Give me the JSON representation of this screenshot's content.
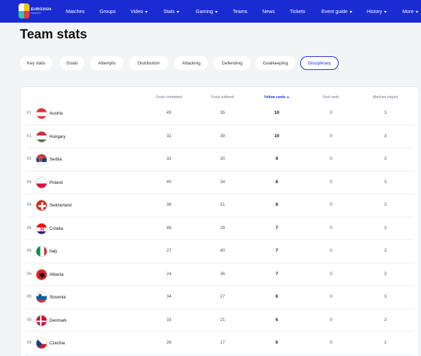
{
  "nav": {
    "logo_text": "EURO2024",
    "logo_sub": "GERMANY",
    "items": [
      {
        "label": "Matches",
        "caret": false
      },
      {
        "label": "Groups",
        "caret": false
      },
      {
        "label": "Video",
        "caret": true
      },
      {
        "label": "Stats",
        "caret": true
      },
      {
        "label": "Gaming",
        "caret": true
      },
      {
        "label": "Teams",
        "caret": false
      },
      {
        "label": "News",
        "caret": false
      },
      {
        "label": "Tickets",
        "caret": false
      },
      {
        "label": "Event guide",
        "caret": true
      },
      {
        "label": "History",
        "caret": true
      },
      {
        "label": "More",
        "caret": true
      }
    ]
  },
  "page": {
    "title": "Team stats"
  },
  "tabs": [
    {
      "label": "Key stats",
      "active": false
    },
    {
      "label": "Goals",
      "active": false
    },
    {
      "label": "Attempts",
      "active": false
    },
    {
      "label": "Distribution",
      "active": false
    },
    {
      "label": "Attacking",
      "active": false
    },
    {
      "label": "Defending",
      "active": false
    },
    {
      "label": "Goalkeeping",
      "active": false
    },
    {
      "label": "Disciplinary",
      "active": true
    }
  ],
  "table": {
    "columns": [
      "Fouls committed",
      "Fouls suffered",
      "Yellow cards",
      "Red cards",
      "Matches played"
    ],
    "sorted_column": "Yellow cards",
    "rows": [
      {
        "rank": "01",
        "team": "Austria",
        "flag": "austria-flag-icon",
        "values": [
          "49",
          "35",
          "10",
          "0",
          "3"
        ]
      },
      {
        "rank": "01",
        "team": "Hungary",
        "flag": "hungary-flag-icon",
        "values": [
          "32",
          "39",
          "10",
          "0",
          "3"
        ]
      },
      {
        "rank": "03",
        "team": "Serbia",
        "flag": "serbia-flag-icon",
        "values": [
          "32",
          "30",
          "9",
          "0",
          "3"
        ]
      },
      {
        "rank": "04",
        "team": "Poland",
        "flag": "poland-flag-icon",
        "values": [
          "40",
          "34",
          "8",
          "0",
          "3"
        ]
      },
      {
        "rank": "04",
        "team": "Switzerland",
        "flag": "switzerland-flag-icon",
        "values": [
          "38",
          "31",
          "8",
          "0",
          "3"
        ]
      },
      {
        "rank": "06",
        "team": "Croatia",
        "flag": "croatia-flag-icon",
        "values": [
          "46",
          "29",
          "7",
          "0",
          "3"
        ]
      },
      {
        "rank": "06",
        "team": "Italy",
        "flag": "italy-flag-icon",
        "values": [
          "27",
          "40",
          "7",
          "0",
          "3"
        ]
      },
      {
        "rank": "06",
        "team": "Albania",
        "flag": "albania-flag-icon",
        "values": [
          "24",
          "36",
          "7",
          "0",
          "3"
        ]
      },
      {
        "rank": "09",
        "team": "Slovenia",
        "flag": "slovenia-flag-icon",
        "values": [
          "34",
          "27",
          "6",
          "0",
          "3"
        ]
      },
      {
        "rank": "09",
        "team": "Denmark",
        "flag": "denmark-flag-icon",
        "values": [
          "33",
          "21",
          "6",
          "0",
          "3"
        ]
      },
      {
        "rank": "09",
        "team": "Czechia",
        "flag": "czechia-flag-icon",
        "values": [
          "26",
          "17",
          "6",
          "0",
          "2"
        ]
      }
    ]
  },
  "colors": {
    "brand": "#1a2cd1",
    "background": "#f3f4f6",
    "card": "#ffffff"
  }
}
